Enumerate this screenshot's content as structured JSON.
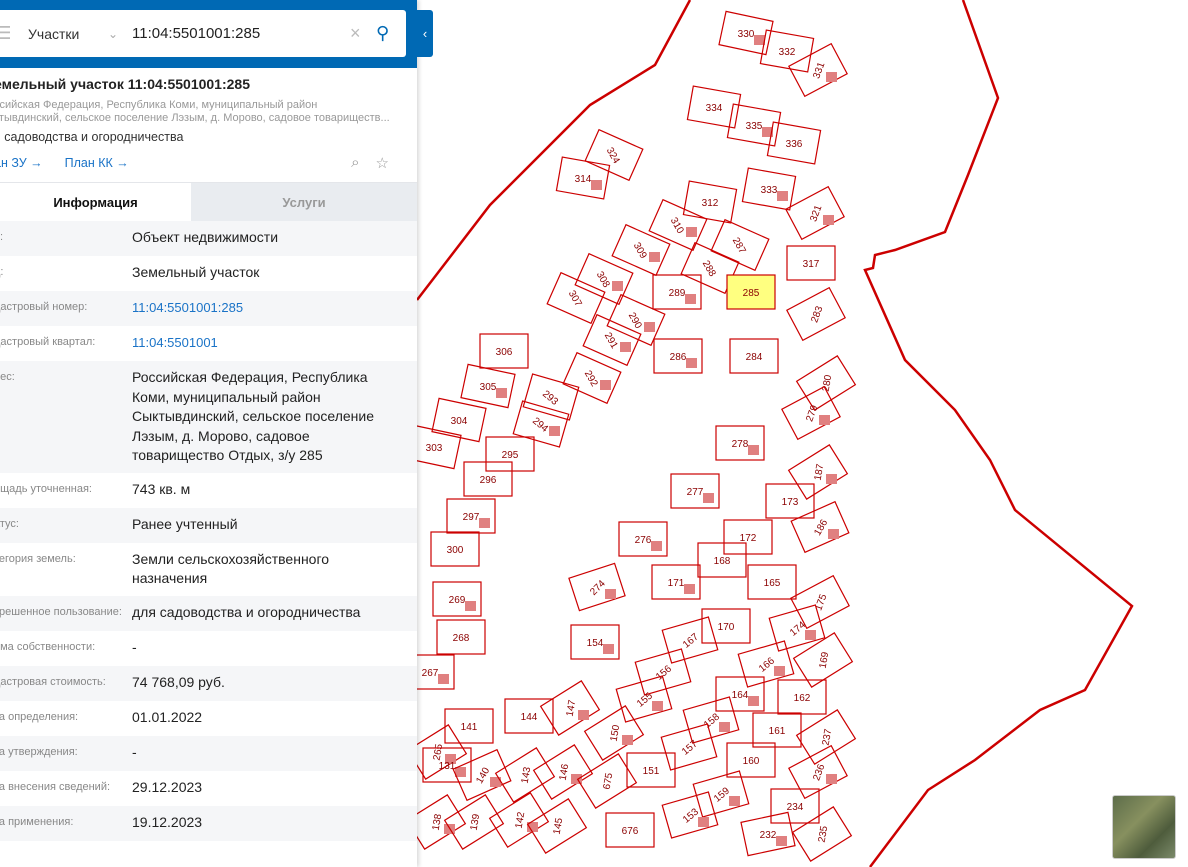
{
  "search": {
    "category": "Участки",
    "query": "11:04:5501001:285"
  },
  "object": {
    "title": "емельный участок 11:04:5501001:285",
    "address_line1": "ссийская Федерация, Республика Коми, муниципальный район",
    "address_line2": "ктывдинский, сельское поселение Лэзым, д. Морово, садовое товариществ...",
    "use": "я садоводства и огородничества",
    "link_zu": "ан ЗУ →",
    "link_kk": "План КК →"
  },
  "tabs": [
    "Информация",
    "Услуги"
  ],
  "info": [
    {
      "label": "п:",
      "value": "Объект недвижимости"
    },
    {
      "label": "д:",
      "value": "Земельный участок"
    },
    {
      "label": "дастровый номер:",
      "value": "11:04:5501001:285",
      "link": true
    },
    {
      "label": "дастровый квартал:",
      "value": "11:04:5501001",
      "link": true
    },
    {
      "label": "рес:",
      "value": "Российская Федерация, Республика Коми, муниципальный район Сыктывдинский, сельское поселение Лэзым, д. Морово, садовое товарищество Отдых, з/у 285"
    },
    {
      "label": "ощадь уточненная:",
      "value": "743 кв. м"
    },
    {
      "label": "атус:",
      "value": "Ранее учтенный"
    },
    {
      "label": "тегория земель:",
      "value": "Земли сельскохозяйственного назначения"
    },
    {
      "label": "зрешенное пользование:",
      "value": "для садоводства и огородничества"
    },
    {
      "label": "рма собственности:",
      "value": "-"
    },
    {
      "label": "дастровая стоимость:",
      "value": "74 768,09 руб."
    },
    {
      "label": "та определения:",
      "value": "01.01.2022"
    },
    {
      "label": "та утверждения:",
      "value": "-"
    },
    {
      "label": "та внесения сведений:",
      "value": "29.12.2023"
    },
    {
      "label": "та применения:",
      "value": "19.12.2023"
    }
  ],
  "map": {
    "selected": "285",
    "colors": {
      "boundary": "#cc0000",
      "selected_fill": "#ffff80",
      "building": "#e08080"
    },
    "parcels": [
      "330",
      "332",
      "331",
      "334",
      "335",
      "336",
      "333",
      "324",
      "314",
      "312",
      "310",
      "287",
      "321",
      "317",
      "309",
      "288",
      "308",
      "307",
      "289",
      "285",
      "290",
      "283",
      "291",
      "306",
      "286",
      "284",
      "292",
      "280",
      "305",
      "293",
      "279",
      "304",
      "294",
      "303",
      "278",
      "295",
      "187",
      "296",
      "277",
      "173",
      "297",
      "172",
      "186",
      "300",
      "276",
      "168",
      "171",
      "165",
      "274",
      "175",
      "269",
      "170",
      "174",
      "268",
      "154",
      "167",
      "166",
      "169",
      "267",
      "156",
      "164",
      "162",
      "155",
      "144",
      "147",
      "141",
      "158",
      "161",
      "150",
      "237",
      "265",
      "157",
      "131",
      "160",
      "140",
      "143",
      "146",
      "151",
      "236",
      "675",
      "159",
      "234",
      "138",
      "139",
      "142",
      "145",
      "153",
      "676",
      "232",
      "235"
    ]
  }
}
